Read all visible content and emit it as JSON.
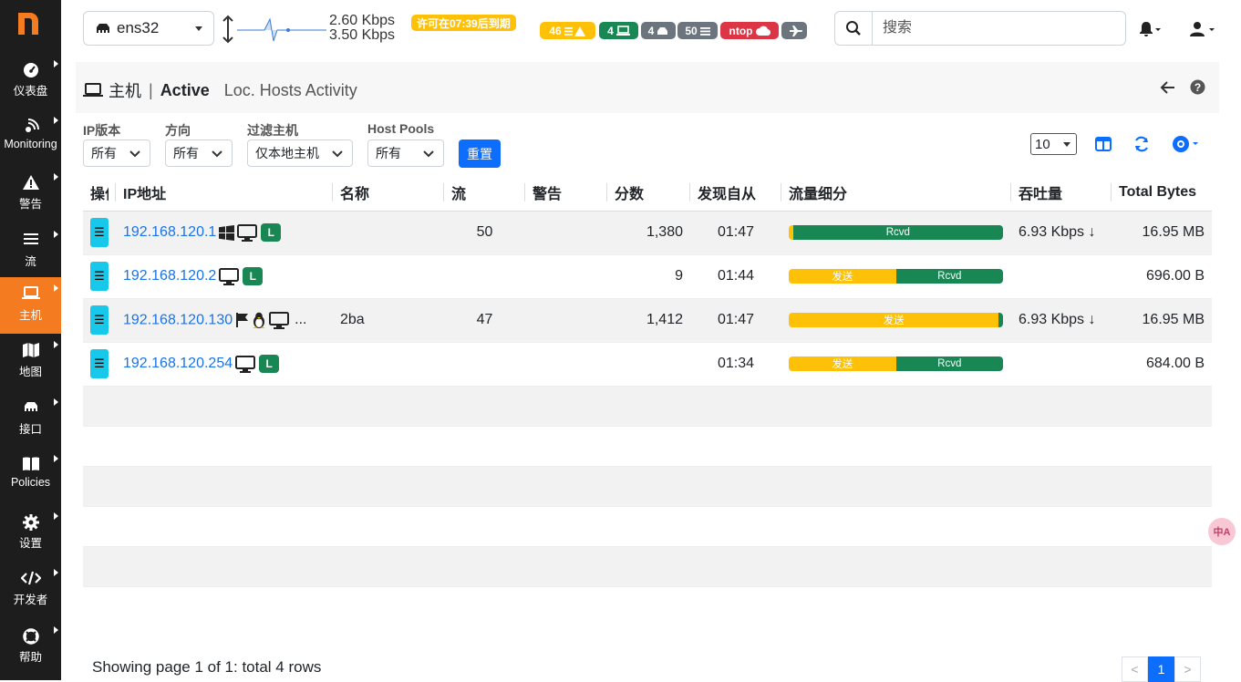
{
  "sidebar": {
    "logo": "n",
    "items": [
      {
        "label": "仪表盘",
        "icon": "gauge-icon"
      },
      {
        "label": "Monitoring",
        "icon": "monitoring-icon"
      },
      {
        "label": "警告",
        "icon": "warning-icon"
      },
      {
        "label": "流",
        "icon": "flows-icon"
      },
      {
        "label": "主机",
        "icon": "laptop-icon",
        "active": true
      },
      {
        "label": "地图",
        "icon": "map-icon"
      },
      {
        "label": "接口",
        "icon": "ethernet-icon"
      },
      {
        "label": "Policies",
        "icon": "book-icon"
      },
      {
        "label": "设置",
        "icon": "gear-icon"
      },
      {
        "label": "开发者",
        "icon": "code-icon"
      },
      {
        "label": "帮助",
        "icon": "lifebuoy-icon"
      }
    ]
  },
  "topbar": {
    "interface": "ens32",
    "throughput_up": "2.60 Kbps",
    "throughput_down": "3.50 Kbps",
    "license_badge": "许可在07:39后到期",
    "badges": [
      {
        "text": "46",
        "icon": "list-warning-icon",
        "color": "#ffc107"
      },
      {
        "text": "4",
        "icon": "laptop-icon",
        "color": "#198754"
      },
      {
        "text": "4",
        "icon": "device-icon",
        "color": "#6c757d"
      },
      {
        "text": "50",
        "icon": "list-icon",
        "color": "#6c757d"
      },
      {
        "text": "ntop",
        "icon": "cloud-icon",
        "color": "#dc3545"
      },
      {
        "text": "",
        "icon": "plane-icon",
        "color": "#6c757d"
      }
    ],
    "search_placeholder": "搜索"
  },
  "header": {
    "section": "主机",
    "sep": "|",
    "active": "Active",
    "subtitle": "Loc. Hosts Activity"
  },
  "filters": [
    {
      "label": "IP版本",
      "value": "所有"
    },
    {
      "label": "方向",
      "value": "所有"
    },
    {
      "label": "过滤主机",
      "value": "仅本地主机"
    },
    {
      "label": "Host Pools",
      "value": "所有"
    }
  ],
  "reset_label": "重置",
  "per_page": "10",
  "table": {
    "columns": [
      "操作",
      "IP地址",
      "名称",
      "流",
      "警告",
      "分数",
      "发现自从",
      "流量细分",
      "吞吐量",
      "Total Bytes"
    ],
    "rows": [
      {
        "ip": "192.168.120.1",
        "icons": [
          "windows-icon",
          "monitor-icon"
        ],
        "local": "L",
        "name": "",
        "flows": "50",
        "alerts": "",
        "score": "1,380",
        "since": "01:47",
        "sent_pct": 2,
        "sent_label": "",
        "rcvd_label": "Rcvd",
        "throughput": "6.93 Kbps",
        "trend": "↓",
        "bytes": "16.95 MB"
      },
      {
        "ip": "192.168.120.2",
        "icons": [
          "monitor-icon"
        ],
        "local": "L",
        "name": "",
        "flows": "",
        "alerts": "",
        "score": "9",
        "since": "01:44",
        "sent_pct": 50,
        "sent_label": "发送",
        "rcvd_label": "Rcvd",
        "throughput": "",
        "trend": "",
        "bytes": "696.00 B"
      },
      {
        "ip": "192.168.120.130",
        "icons": [
          "flag-icon",
          "linux-icon",
          "monitor-icon"
        ],
        "local": "...",
        "name": "2ba",
        "flows": "47",
        "alerts": "",
        "score": "1,412",
        "since": "01:47",
        "sent_pct": 98,
        "sent_label": "发送",
        "rcvd_label": "",
        "throughput": "6.93 Kbps",
        "trend": "↓",
        "bytes": "16.95 MB"
      },
      {
        "ip": "192.168.120.254",
        "icons": [
          "monitor-icon"
        ],
        "local": "L",
        "name": "",
        "flows": "",
        "alerts": "",
        "score": "",
        "since": "01:34",
        "sent_pct": 50,
        "sent_label": "发送",
        "rcvd_label": "Rcvd",
        "throughput": "",
        "trend": "",
        "bytes": "684.00 B"
      }
    ]
  },
  "footer": {
    "text": "Showing page 1 of 1: total 4 rows",
    "prev": "<",
    "page": "1",
    "next": ">"
  },
  "float_button": "中A"
}
